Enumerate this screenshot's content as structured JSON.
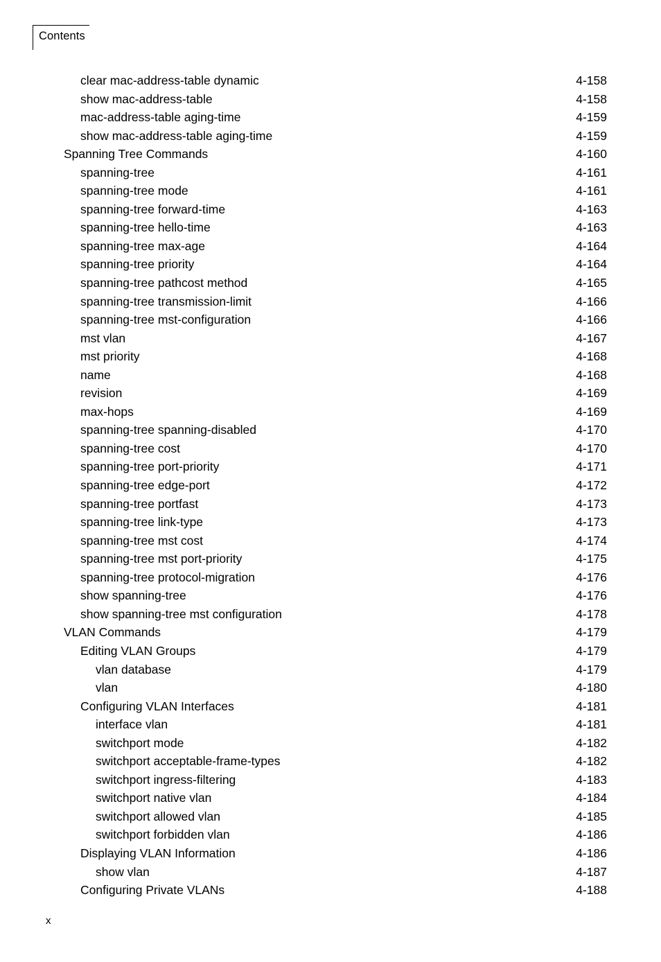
{
  "header": {
    "title": "Contents"
  },
  "footer": {
    "page_number": "x"
  },
  "toc": {
    "entries": [
      {
        "label": "clear mac-address-table dynamic",
        "page": "4-158",
        "level": 2
      },
      {
        "label": "show mac-address-table",
        "page": "4-158",
        "level": 2
      },
      {
        "label": "mac-address-table aging-time",
        "page": "4-159",
        "level": 2
      },
      {
        "label": "show mac-address-table aging-time",
        "page": "4-159",
        "level": 2
      },
      {
        "label": "Spanning Tree Commands",
        "page": "4-160",
        "level": 1
      },
      {
        "label": "spanning-tree",
        "page": "4-161",
        "level": 2
      },
      {
        "label": "spanning-tree mode",
        "page": "4-161",
        "level": 2
      },
      {
        "label": "spanning-tree forward-time",
        "page": "4-163",
        "level": 2
      },
      {
        "label": "spanning-tree hello-time",
        "page": "4-163",
        "level": 2
      },
      {
        "label": "spanning-tree max-age",
        "page": "4-164",
        "level": 2
      },
      {
        "label": "spanning-tree priority",
        "page": "4-164",
        "level": 2
      },
      {
        "label": "spanning-tree pathcost method",
        "page": "4-165",
        "level": 2
      },
      {
        "label": "spanning-tree transmission-limit",
        "page": "4-166",
        "level": 2
      },
      {
        "label": "spanning-tree mst-configuration",
        "page": "4-166",
        "level": 2
      },
      {
        "label": "mst vlan",
        "page": "4-167",
        "level": 2
      },
      {
        "label": "mst priority",
        "page": "4-168",
        "level": 2
      },
      {
        "label": "name",
        "page": "4-168",
        "level": 2
      },
      {
        "label": "revision",
        "page": "4-169",
        "level": 2
      },
      {
        "label": "max-hops",
        "page": "4-169",
        "level": 2
      },
      {
        "label": "spanning-tree spanning-disabled",
        "page": "4-170",
        "level": 2
      },
      {
        "label": "spanning-tree cost",
        "page": "4-170",
        "level": 2
      },
      {
        "label": "spanning-tree port-priority",
        "page": "4-171",
        "level": 2
      },
      {
        "label": "spanning-tree edge-port",
        "page": "4-172",
        "level": 2
      },
      {
        "label": "spanning-tree portfast",
        "page": "4-173",
        "level": 2
      },
      {
        "label": "spanning-tree link-type",
        "page": "4-173",
        "level": 2
      },
      {
        "label": "spanning-tree mst cost",
        "page": "4-174",
        "level": 2
      },
      {
        "label": "spanning-tree mst port-priority",
        "page": "4-175",
        "level": 2
      },
      {
        "label": "spanning-tree protocol-migration",
        "page": "4-176",
        "level": 2
      },
      {
        "label": "show spanning-tree",
        "page": "4-176",
        "level": 2
      },
      {
        "label": "show spanning-tree mst configuration",
        "page": "4-178",
        "level": 2
      },
      {
        "label": "VLAN Commands",
        "page": "4-179",
        "level": 1
      },
      {
        "label": "Editing VLAN Groups",
        "page": "4-179",
        "level": 2
      },
      {
        "label": "vlan database",
        "page": "4-179",
        "level": 3
      },
      {
        "label": "vlan",
        "page": "4-180",
        "level": 3
      },
      {
        "label": "Configuring VLAN Interfaces",
        "page": "4-181",
        "level": 2
      },
      {
        "label": "interface vlan",
        "page": "4-181",
        "level": 3
      },
      {
        "label": "switchport mode",
        "page": "4-182",
        "level": 3
      },
      {
        "label": "switchport acceptable-frame-types",
        "page": "4-182",
        "level": 3
      },
      {
        "label": "switchport ingress-filtering",
        "page": "4-183",
        "level": 3
      },
      {
        "label": "switchport native vlan",
        "page": "4-184",
        "level": 3
      },
      {
        "label": "switchport allowed vlan",
        "page": "4-185",
        "level": 3
      },
      {
        "label": "switchport forbidden vlan",
        "page": "4-186",
        "level": 3
      },
      {
        "label": "Displaying VLAN Information",
        "page": "4-186",
        "level": 2
      },
      {
        "label": "show vlan",
        "page": "4-187",
        "level": 3
      },
      {
        "label": "Configuring Private VLANs",
        "page": "4-188",
        "level": 2
      }
    ]
  }
}
